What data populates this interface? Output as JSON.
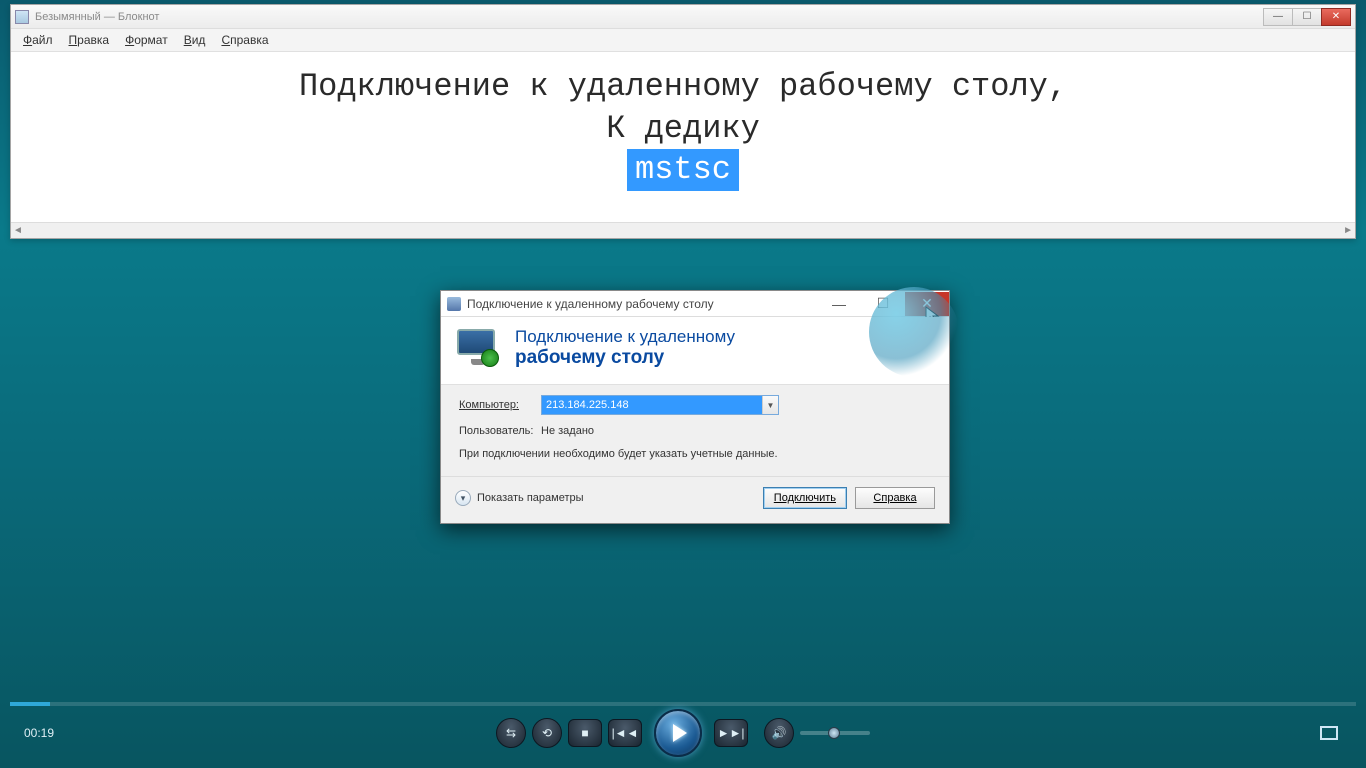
{
  "notepad": {
    "title": "Безымянный — Блокнот",
    "menus": [
      "Файл",
      "Правка",
      "Формат",
      "Вид",
      "Справка"
    ],
    "line1": "Подключение к удаленному рабочему столу,",
    "line2": "К дедику",
    "line3_highlight": "mstsc"
  },
  "rdp": {
    "title": "Подключение к удаленному рабочему столу",
    "header_line1": "Подключение к удаленному",
    "header_line2": "рабочему столу",
    "computer_label": "Компьютер:",
    "computer_value": "213.184.225.148",
    "user_label": "Пользователь:",
    "user_value": "Не задано",
    "note": "При подключении необходимо будет указать учетные данные.",
    "show_options": "Показать параметры",
    "connect": "Подключить",
    "help": "Справка"
  },
  "player": {
    "time": "00:19"
  }
}
